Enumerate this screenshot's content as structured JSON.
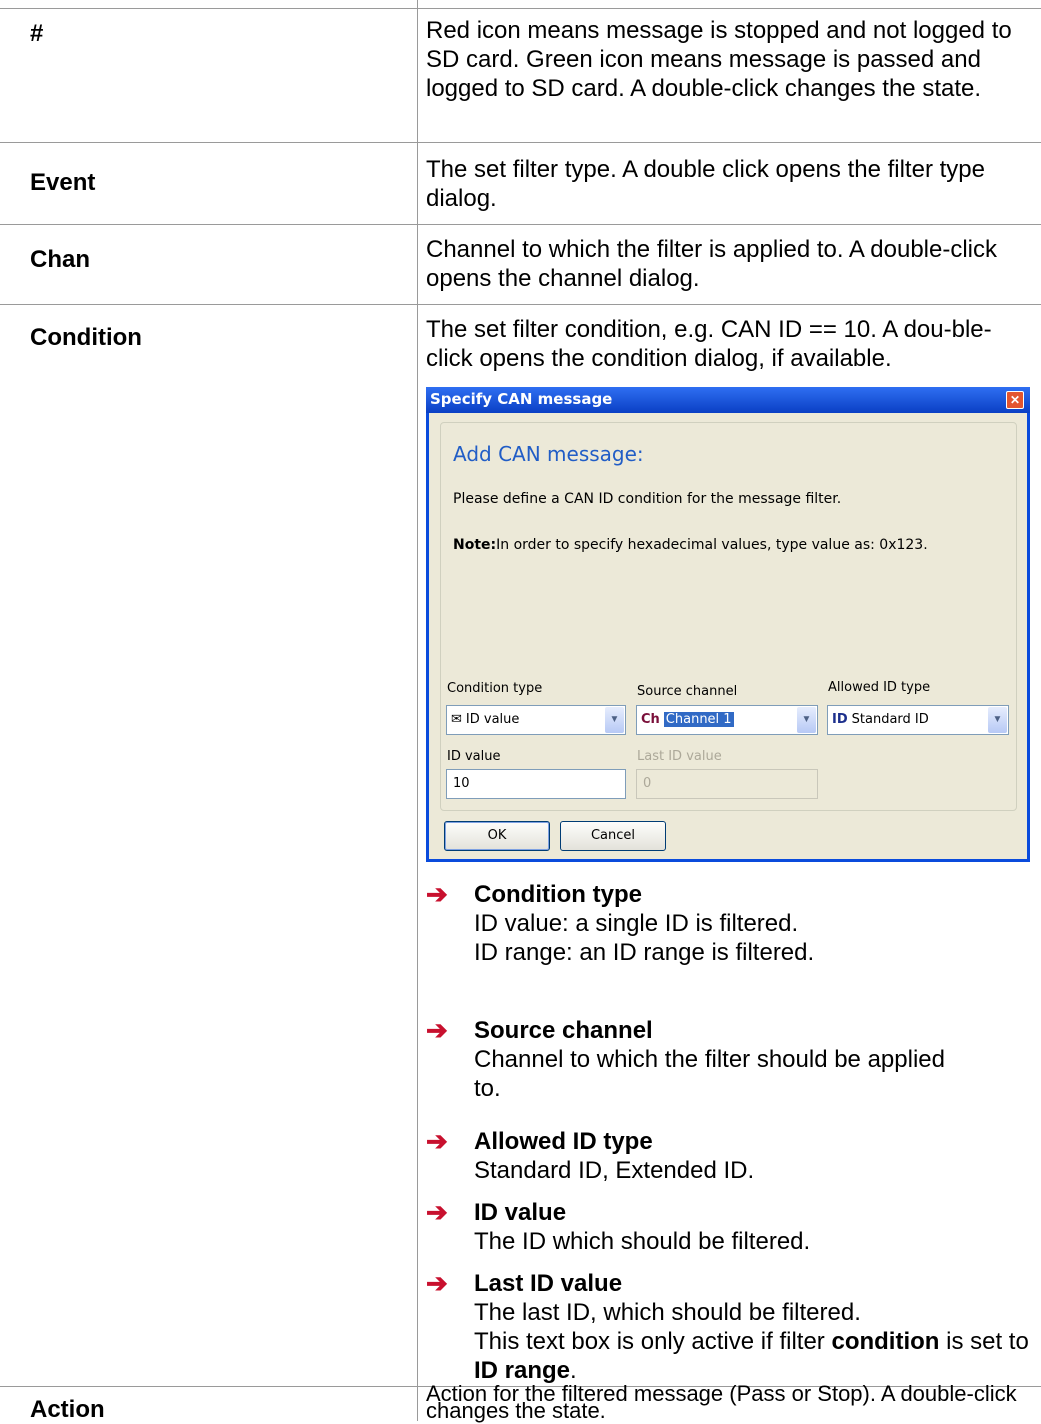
{
  "rows": [
    {
      "term": "#",
      "desc": "Red icon means message is stopped and not logged to SD card. Green icon means message is passed and logged to SD card. A double-click changes the state."
    },
    {
      "term": "Event",
      "desc": "The set filter type. A double click opens the filter type dialog."
    },
    {
      "term": "Chan",
      "desc": "Channel to which the filter is applied to. A double-click opens the channel dialog."
    },
    {
      "term": "Condition",
      "desc": "The set filter condition, e.g. CAN ID == 10. A dou-ble-click opens the condition dialog, if available."
    },
    {
      "term": "Action",
      "desc": "Action for the filtered message (Pass or Stop). A double-click changes the state."
    }
  ],
  "dialog": {
    "title": "Specify CAN message",
    "close_glyph": "✕",
    "heading": "Add CAN message:",
    "instruction": "Please define a CAN ID condition for the message filter.",
    "note_label": "Note:",
    "note_text": "In order to specify hexadecimal values, type value as: 0x123.",
    "condition_type": {
      "label": "Condition type",
      "value": "ID value",
      "icon": "✉"
    },
    "source_channel": {
      "label": "Source channel",
      "value": "Channel 1",
      "icon": "Ch"
    },
    "allowed_id_type": {
      "label": "Allowed ID type",
      "value": "Standard ID",
      "icon": "ID"
    },
    "id_value": {
      "label": "ID value",
      "value": "10"
    },
    "last_id_value": {
      "label": "Last ID value",
      "value": "0"
    },
    "ok_label": "OK",
    "cancel_label": "Cancel",
    "dropdown_glyph": "▼",
    "accent_color": "#0a4bdc"
  },
  "bullets": [
    {
      "arrow": "➔",
      "title": "Condition type",
      "lines": [
        "ID value: a single ID is filtered.",
        "ID range: an ID range is filtered."
      ]
    },
    {
      "arrow": "➔",
      "title": "Source channel",
      "lines": [
        "Channel to which the filter should be applied",
        "to."
      ]
    },
    {
      "arrow": "➔",
      "title": "Allowed ID type",
      "lines": [
        "Standard ID, Extended ID."
      ]
    },
    {
      "arrow": "➔",
      "title": "ID value",
      "lines": [
        "The ID which should be filtered."
      ]
    },
    {
      "arrow": "➔",
      "title": "Last ID value",
      "lines": [
        "The last ID, which should be filtered."
      ],
      "extra": {
        "pre": "This text box is only active if filter ",
        "bold1": "condition",
        "mid": " is set to ",
        "bold2": "ID range",
        "post": "."
      }
    }
  ]
}
